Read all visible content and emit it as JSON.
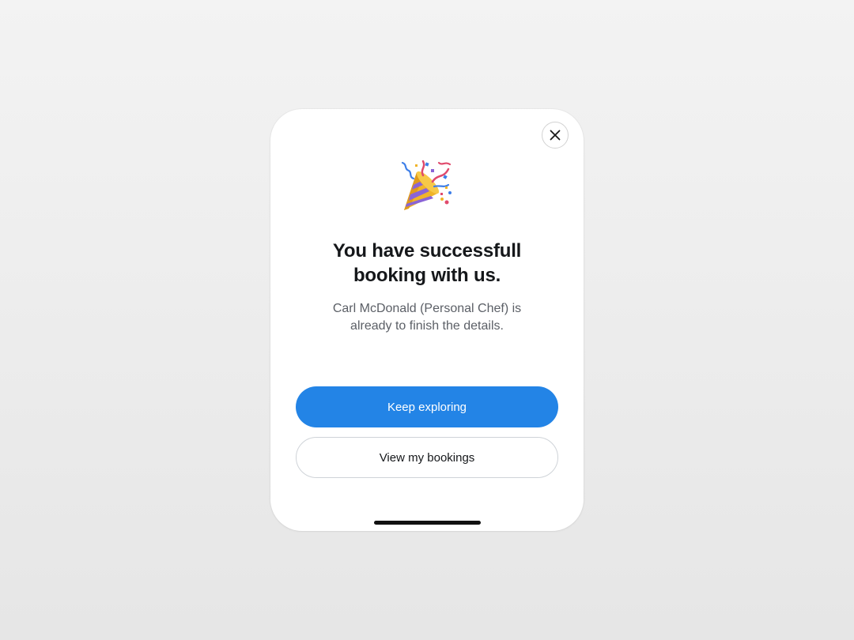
{
  "modal": {
    "icon": "party-popper-icon",
    "title_line1": "You have successfull",
    "title_line2": "booking with us.",
    "message_line1": "Carl McDonald (Personal Chef) is",
    "message_line2": "already to finish the details.",
    "close_icon": "close-icon"
  },
  "actions": {
    "primary_label": "Keep exploring",
    "secondary_label": "View my bookings"
  },
  "colors": {
    "primary": "#2384e6",
    "title": "#15171a",
    "body_text": "#5b5f66"
  }
}
